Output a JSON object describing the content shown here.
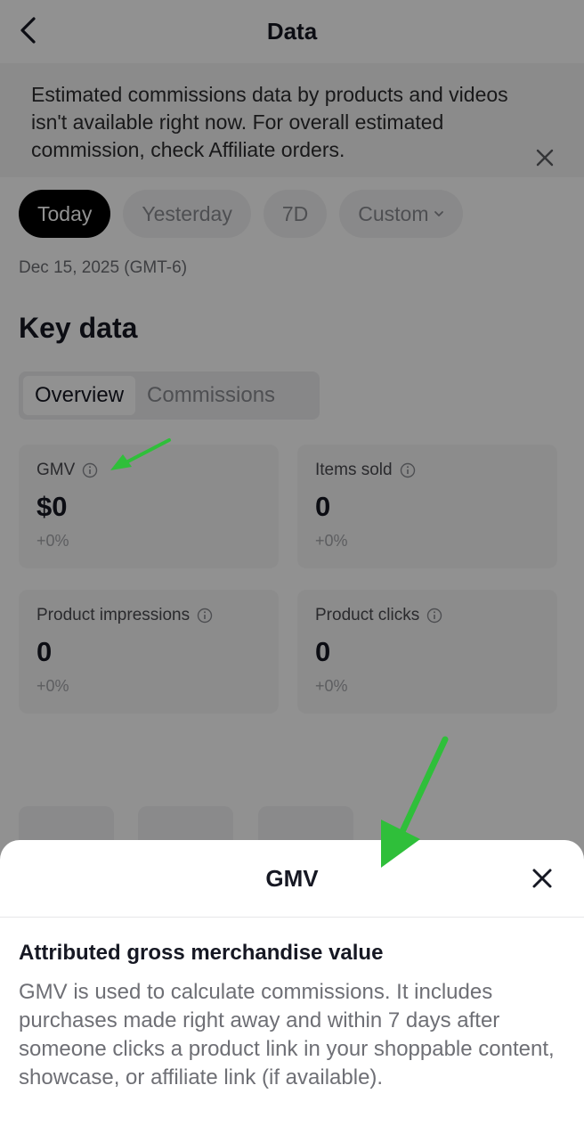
{
  "header": {
    "title": "Data"
  },
  "banner": {
    "text": "Estimated commissions data by products and videos isn't available right now. For overall estimated commission, check Affiliate orders."
  },
  "date_range": {
    "chips": [
      "Today",
      "Yesterday",
      "7D",
      "Custom"
    ],
    "selected": "Today",
    "date": "Dec 15, 2025 (GMT-6)"
  },
  "key_data": {
    "title": "Key data",
    "tabs": [
      "Overview",
      "Commissions"
    ],
    "selected_tab": "Overview",
    "metrics": [
      {
        "label": "GMV",
        "value": "$0",
        "delta": "+0%"
      },
      {
        "label": "Items sold",
        "value": "0",
        "delta": "+0%"
      },
      {
        "label": "Product impressions",
        "value": "0",
        "delta": "+0%"
      },
      {
        "label": "Product clicks",
        "value": "0",
        "delta": "+0%"
      }
    ]
  },
  "sheet": {
    "title": "GMV",
    "heading": "Attributed gross merchandise value",
    "body": "GMV is used to calculate commissions. It includes purchases made right away and within 7 days after someone clicks a product link in your shoppable content, showcase, or affiliate link (if available)."
  },
  "colors": {
    "annotation_arrow": "#2fbf3a",
    "primary_chip": "#000000",
    "overlay": "#6f6f6f"
  },
  "icons": {
    "back": "chevron-left-icon",
    "close": "close-icon",
    "info": "info-icon",
    "caret": "chevron-down-icon"
  }
}
